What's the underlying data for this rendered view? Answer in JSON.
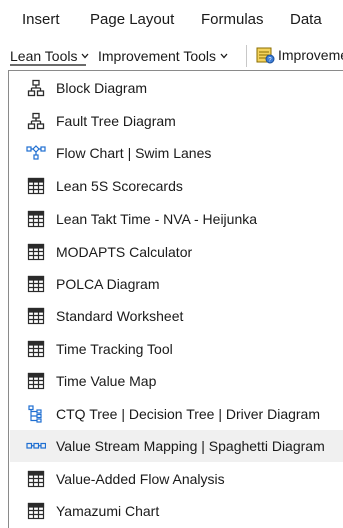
{
  "ribbon": {
    "tabs": [
      "Insert",
      "Page Layout",
      "Formulas",
      "Data"
    ]
  },
  "toolbar": {
    "lean_tools": "Lean Tools",
    "improvement_tools": "Improvement Tools",
    "improvement_cut": "Improveme",
    "caret": "⌄"
  },
  "menu": {
    "items": [
      {
        "label": "Block Diagram",
        "icon": "hierarchy-icon"
      },
      {
        "label": "Fault Tree Diagram",
        "icon": "hierarchy-icon"
      },
      {
        "label": "Flow Chart | Swim Lanes",
        "icon": "flowchart-icon"
      },
      {
        "label": "Lean 5S Scorecards",
        "icon": "table-icon"
      },
      {
        "label": "Lean Takt Time - NVA - Heijunka",
        "icon": "table-icon"
      },
      {
        "label": "MODAPTS Calculator",
        "icon": "table-icon"
      },
      {
        "label": "POLCA Diagram",
        "icon": "table-icon"
      },
      {
        "label": "Standard Worksheet",
        "icon": "table-icon"
      },
      {
        "label": "Time Tracking Tool",
        "icon": "table-icon"
      },
      {
        "label": "Time Value Map",
        "icon": "table-icon"
      },
      {
        "label": "CTQ Tree | Decision Tree | Driver Diagram",
        "icon": "tree-icon"
      },
      {
        "label": "Value Stream Mapping | Spaghetti Diagram",
        "icon": "value-stream-icon"
      },
      {
        "label": "Value-Added Flow Analysis",
        "icon": "table-icon"
      },
      {
        "label": "Yamazumi Chart",
        "icon": "table-icon"
      }
    ],
    "highlighted_index": 11
  },
  "colors": {
    "accent_blue": "#1f6fd1",
    "highlight_bg": "#f0f0f0"
  }
}
